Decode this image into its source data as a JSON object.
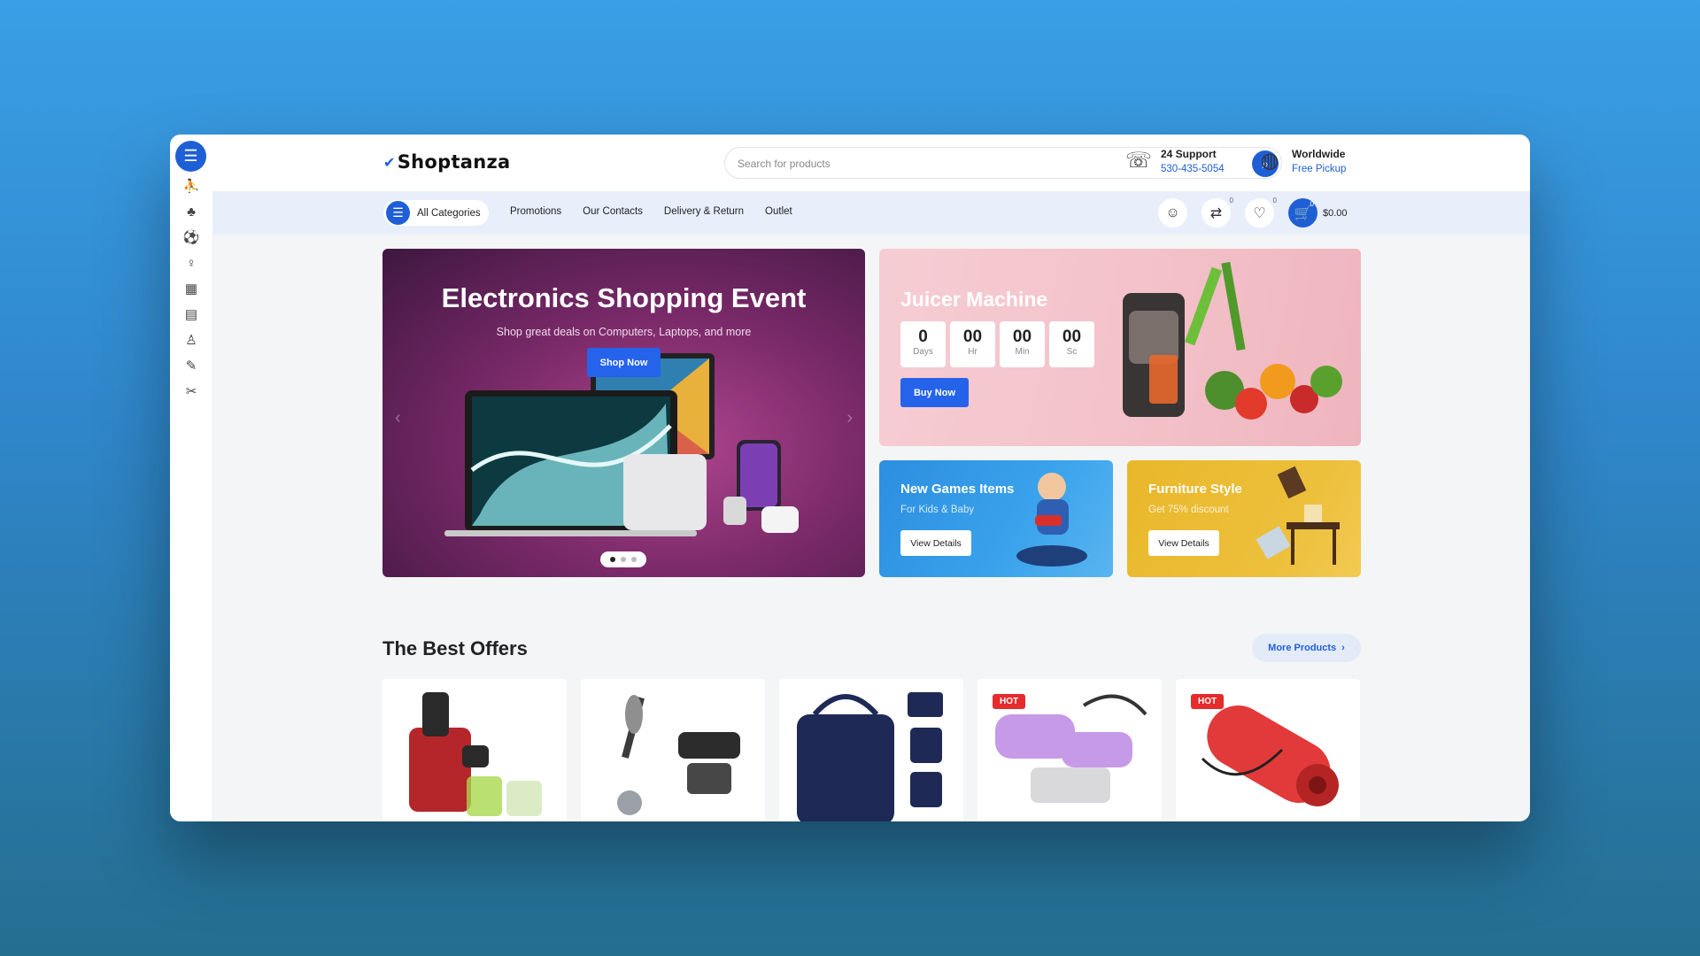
{
  "rail": {
    "menu_icon": "hamburger-icon",
    "items": [
      "fitness-icon",
      "clothing-icon",
      "sports-icon",
      "beauty-icon",
      "kitchen-icon",
      "furniture-icon",
      "toys-icon",
      "tools-icon",
      "outdoor-icon"
    ]
  },
  "header": {
    "logo": "Shoptanza",
    "search_placeholder": "Search for products",
    "support_title": "24 Support",
    "support_phone": "530-435-5054",
    "shipping_title": "Worldwide",
    "shipping_sub": "Free Pickup"
  },
  "nav": {
    "all_categories": "All Categories",
    "links": [
      "Promotions",
      "Our Contacts",
      "Delivery & Return",
      "Outlet"
    ],
    "compare_count": "0",
    "wishlist_count": "0",
    "cart_count": "0",
    "cart_total": "$0.00"
  },
  "hero": {
    "title": "Electronics Shopping Event",
    "subtitle": "Shop great deals on Computers, Laptops, and more",
    "button": "Shop Now",
    "slides": 3,
    "active_slide": 1
  },
  "juicer": {
    "title": "Juicer Machine",
    "countdown": [
      {
        "value": "0",
        "label": "Days"
      },
      {
        "value": "00",
        "label": "Hr"
      },
      {
        "value": "00",
        "label": "Min"
      },
      {
        "value": "00",
        "label": "Sc"
      }
    ],
    "button": "Buy Now"
  },
  "games": {
    "title": "New Games Items",
    "subtitle": "For Kids & Baby",
    "button": "View Details"
  },
  "furniture": {
    "title": "Furniture Style",
    "subtitle": "Get 75% discount",
    "button": "View Details"
  },
  "offers": {
    "title": "The Best Offers",
    "more": "More Products",
    "products": [
      {
        "name": "juicer",
        "hot": false
      },
      {
        "name": "ab-machine",
        "hot": false
      },
      {
        "name": "travel-bag",
        "hot": false
      },
      {
        "name": "stepper",
        "hot": true,
        "badge": "HOT"
      },
      {
        "name": "yoga-mat",
        "hot": true,
        "badge": "HOT"
      }
    ]
  },
  "colors": {
    "accent": "#1f5fd6",
    "hot": "#e52b2b",
    "background": "#3a9fe6"
  }
}
